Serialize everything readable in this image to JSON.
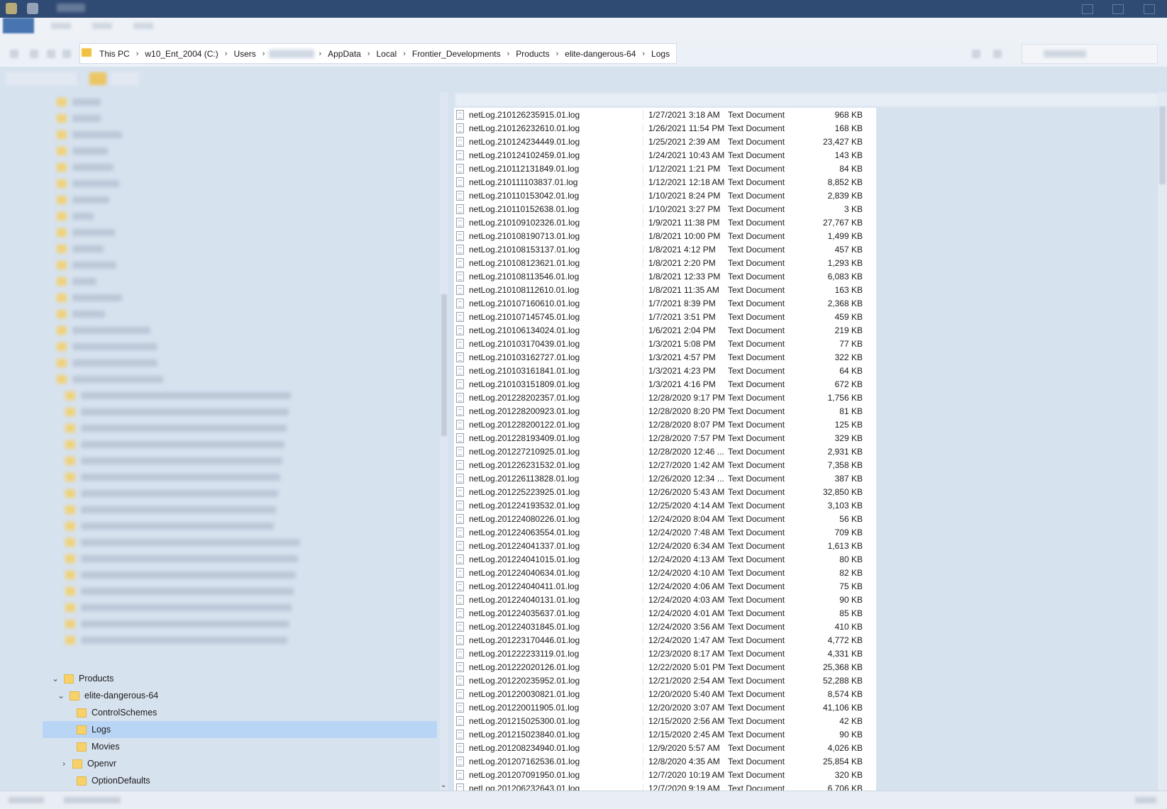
{
  "titlebar": {
    "icons": [
      "folder-icon",
      "save-icon"
    ]
  },
  "ribbon": {},
  "address": {
    "path": [
      {
        "label": "This PC"
      },
      {
        "label": "w10_Ent_2004 (C:)"
      },
      {
        "label": "Users"
      },
      {
        "label": ""
      },
      {
        "label": "AppData"
      },
      {
        "label": "Local"
      },
      {
        "label": "Frontier_Developments"
      },
      {
        "label": "Products"
      },
      {
        "label": "elite-dangerous-64"
      },
      {
        "label": "Logs"
      }
    ],
    "separator": "›"
  },
  "tree": {
    "items": [
      {
        "label": "Products",
        "expand": "⌄",
        "level": 1
      },
      {
        "label": "elite-dangerous-64",
        "expand": "⌄",
        "level": 2
      },
      {
        "label": "ControlSchemes",
        "expand": "",
        "level": 3
      },
      {
        "label": "Logs",
        "expand": "",
        "level": 3,
        "selected": true
      },
      {
        "label": "Movies",
        "expand": "",
        "level": 3
      },
      {
        "label": "Openvr",
        "expand": "›",
        "level": 3
      },
      {
        "label": "OptionDefaults",
        "expand": "",
        "level": 3
      }
    ]
  },
  "files": [
    {
      "name": "netLog.210126235915.01.log",
      "date": "1/27/2021 3:18 AM",
      "type": "Text Document",
      "size": "968 KB"
    },
    {
      "name": "netLog.210126232610.01.log",
      "date": "1/26/2021 11:54 PM",
      "type": "Text Document",
      "size": "168 KB"
    },
    {
      "name": "netLog.210124234449.01.log",
      "date": "1/25/2021 2:39 AM",
      "type": "Text Document",
      "size": "23,427 KB"
    },
    {
      "name": "netLog.210124102459.01.log",
      "date": "1/24/2021 10:43 AM",
      "type": "Text Document",
      "size": "143 KB"
    },
    {
      "name": "netLog.210112131849.01.log",
      "date": "1/12/2021 1:21 PM",
      "type": "Text Document",
      "size": "84 KB"
    },
    {
      "name": "netLog.210111103837.01.log",
      "date": "1/12/2021 12:18 AM",
      "type": "Text Document",
      "size": "8,852 KB"
    },
    {
      "name": "netLog.210110153042.01.log",
      "date": "1/10/2021 8:24 PM",
      "type": "Text Document",
      "size": "2,839 KB"
    },
    {
      "name": "netLog.210110152638.01.log",
      "date": "1/10/2021 3:27 PM",
      "type": "Text Document",
      "size": "3 KB"
    },
    {
      "name": "netLog.210109102326.01.log",
      "date": "1/9/2021 11:38 PM",
      "type": "Text Document",
      "size": "27,767 KB"
    },
    {
      "name": "netLog.210108190713.01.log",
      "date": "1/8/2021 10:00 PM",
      "type": "Text Document",
      "size": "1,499 KB"
    },
    {
      "name": "netLog.210108153137.01.log",
      "date": "1/8/2021 4:12 PM",
      "type": "Text Document",
      "size": "457 KB"
    },
    {
      "name": "netLog.210108123621.01.log",
      "date": "1/8/2021 2:20 PM",
      "type": "Text Document",
      "size": "1,293 KB"
    },
    {
      "name": "netLog.210108113546.01.log",
      "date": "1/8/2021 12:33 PM",
      "type": "Text Document",
      "size": "6,083 KB"
    },
    {
      "name": "netLog.210108112610.01.log",
      "date": "1/8/2021 11:35 AM",
      "type": "Text Document",
      "size": "163 KB"
    },
    {
      "name": "netLog.210107160610.01.log",
      "date": "1/7/2021 8:39 PM",
      "type": "Text Document",
      "size": "2,368 KB"
    },
    {
      "name": "netLog.210107145745.01.log",
      "date": "1/7/2021 3:51 PM",
      "type": "Text Document",
      "size": "459 KB"
    },
    {
      "name": "netLog.210106134024.01.log",
      "date": "1/6/2021 2:04 PM",
      "type": "Text Document",
      "size": "219 KB"
    },
    {
      "name": "netLog.210103170439.01.log",
      "date": "1/3/2021 5:08 PM",
      "type": "Text Document",
      "size": "77 KB"
    },
    {
      "name": "netLog.210103162727.01.log",
      "date": "1/3/2021 4:57 PM",
      "type": "Text Document",
      "size": "322 KB"
    },
    {
      "name": "netLog.210103161841.01.log",
      "date": "1/3/2021 4:23 PM",
      "type": "Text Document",
      "size": "64 KB"
    },
    {
      "name": "netLog.210103151809.01.log",
      "date": "1/3/2021 4:16 PM",
      "type": "Text Document",
      "size": "672 KB"
    },
    {
      "name": "netLog.201228202357.01.log",
      "date": "12/28/2020 9:17 PM",
      "type": "Text Document",
      "size": "1,756 KB"
    },
    {
      "name": "netLog.201228200923.01.log",
      "date": "12/28/2020 8:20 PM",
      "type": "Text Document",
      "size": "81 KB"
    },
    {
      "name": "netLog.201228200122.01.log",
      "date": "12/28/2020 8:07 PM",
      "type": "Text Document",
      "size": "125 KB"
    },
    {
      "name": "netLog.201228193409.01.log",
      "date": "12/28/2020 7:57 PM",
      "type": "Text Document",
      "size": "329 KB"
    },
    {
      "name": "netLog.201227210925.01.log",
      "date": "12/28/2020 12:46 ...",
      "type": "Text Document",
      "size": "2,931 KB"
    },
    {
      "name": "netLog.201226231532.01.log",
      "date": "12/27/2020 1:42 AM",
      "type": "Text Document",
      "size": "7,358 KB"
    },
    {
      "name": "netLog.201226113828.01.log",
      "date": "12/26/2020 12:34 ...",
      "type": "Text Document",
      "size": "387 KB"
    },
    {
      "name": "netLog.201225223925.01.log",
      "date": "12/26/2020 5:43 AM",
      "type": "Text Document",
      "size": "32,850 KB"
    },
    {
      "name": "netLog.201224193532.01.log",
      "date": "12/25/2020 4:14 AM",
      "type": "Text Document",
      "size": "3,103 KB"
    },
    {
      "name": "netLog.201224080226.01.log",
      "date": "12/24/2020 8:04 AM",
      "type": "Text Document",
      "size": "56 KB"
    },
    {
      "name": "netLog.201224063554.01.log",
      "date": "12/24/2020 7:48 AM",
      "type": "Text Document",
      "size": "709 KB"
    },
    {
      "name": "netLog.201224041337.01.log",
      "date": "12/24/2020 6:34 AM",
      "type": "Text Document",
      "size": "1,613 KB"
    },
    {
      "name": "netLog.201224041015.01.log",
      "date": "12/24/2020 4:13 AM",
      "type": "Text Document",
      "size": "80 KB"
    },
    {
      "name": "netLog.201224040634.01.log",
      "date": "12/24/2020 4:10 AM",
      "type": "Text Document",
      "size": "82 KB"
    },
    {
      "name": "netLog.201224040411.01.log",
      "date": "12/24/2020 4:06 AM",
      "type": "Text Document",
      "size": "75 KB"
    },
    {
      "name": "netLog.201224040131.01.log",
      "date": "12/24/2020 4:03 AM",
      "type": "Text Document",
      "size": "90 KB"
    },
    {
      "name": "netLog.201224035637.01.log",
      "date": "12/24/2020 4:01 AM",
      "type": "Text Document",
      "size": "85 KB"
    },
    {
      "name": "netLog.201224031845.01.log",
      "date": "12/24/2020 3:56 AM",
      "type": "Text Document",
      "size": "410 KB"
    },
    {
      "name": "netLog.201223170446.01.log",
      "date": "12/24/2020 1:47 AM",
      "type": "Text Document",
      "size": "4,772 KB"
    },
    {
      "name": "netLog.201222233119.01.log",
      "date": "12/23/2020 8:17 AM",
      "type": "Text Document",
      "size": "4,331 KB"
    },
    {
      "name": "netLog.201222020126.01.log",
      "date": "12/22/2020 5:01 PM",
      "type": "Text Document",
      "size": "25,368 KB"
    },
    {
      "name": "netLog.201220235952.01.log",
      "date": "12/21/2020 2:54 AM",
      "type": "Text Document",
      "size": "52,288 KB"
    },
    {
      "name": "netLog.201220030821.01.log",
      "date": "12/20/2020 5:40 AM",
      "type": "Text Document",
      "size": "8,574 KB"
    },
    {
      "name": "netLog.201220011905.01.log",
      "date": "12/20/2020 3:07 AM",
      "type": "Text Document",
      "size": "41,106 KB"
    },
    {
      "name": "netLog.201215025300.01.log",
      "date": "12/15/2020 2:56 AM",
      "type": "Text Document",
      "size": "42 KB"
    },
    {
      "name": "netLog.201215023840.01.log",
      "date": "12/15/2020 2:45 AM",
      "type": "Text Document",
      "size": "90 KB"
    },
    {
      "name": "netLog.201208234940.01.log",
      "date": "12/9/2020 5:57 AM",
      "type": "Text Document",
      "size": "4,026 KB"
    },
    {
      "name": "netLog.201207162536.01.log",
      "date": "12/8/2020 4:35 AM",
      "type": "Text Document",
      "size": "25,854 KB"
    },
    {
      "name": "netLog.201207091950.01.log",
      "date": "12/7/2020 10:19 AM",
      "type": "Text Document",
      "size": "320 KB"
    },
    {
      "name": "netLog.201206232643.01.log",
      "date": "12/7/2020 9:19 AM",
      "type": "Text Document",
      "size": "6,706 KB"
    }
  ]
}
